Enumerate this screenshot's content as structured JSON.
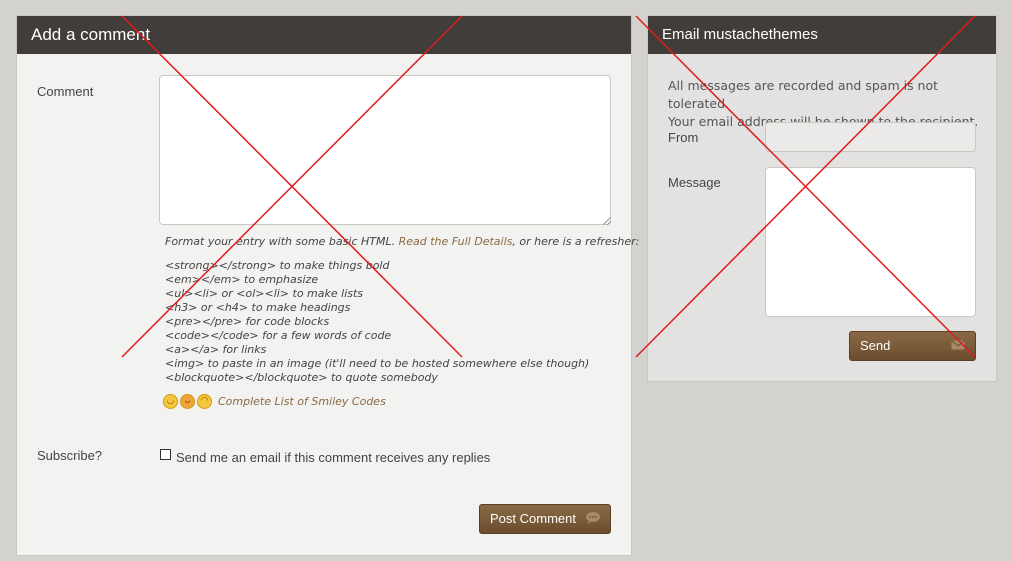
{
  "comment_form": {
    "title": "Add a comment",
    "comment_label": "Comment",
    "comment_value": "",
    "format_intro_before": "Format your entry with some basic HTML. ",
    "format_link": "Read the Full Details",
    "format_intro_after": ", or here is a refresher:",
    "format_lines": [
      "<strong></strong> to make things bold",
      "<em></em> to emphasize",
      "<ul><li> or <ol><li> to make lists",
      "<h3> or <h4> to make headings",
      "<pre></pre> for code blocks",
      "<code></code> for a few words of code",
      "<a></a> for links",
      "<img> to paste in an image (it'll need to be hosted somewhere else though)",
      "<blockquote></blockquote> to quote somebody"
    ],
    "smiley_link": "Complete List of Smiley Codes",
    "subscribe_label": "Subscribe?",
    "subscribe_text": "Send me an email if this comment receives any replies",
    "subscribe_checked": false,
    "submit_label": "Post Comment"
  },
  "email_form": {
    "title": "Email mustachethemes",
    "info_line1": "All messages are recorded and spam is not tolerated.",
    "info_line2": "Your email address will be shown to the recipient.",
    "from_label": "From",
    "from_value": "",
    "message_label": "Message",
    "message_value": "",
    "send_label": "Send"
  },
  "colors": {
    "header_bg": "#403d3a",
    "button_bg": "#7a5b3a",
    "link": "#8b6a44",
    "cross": "#e01b1b"
  }
}
